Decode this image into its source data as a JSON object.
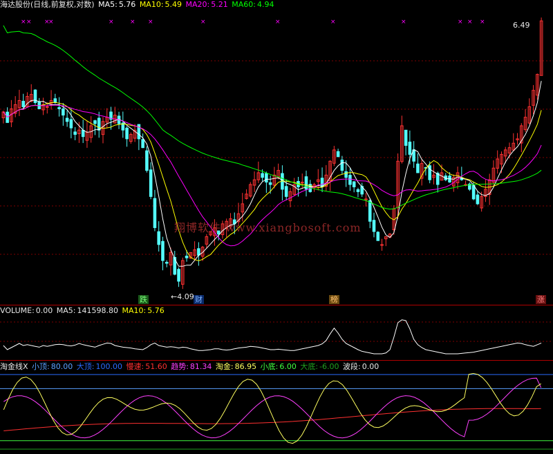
{
  "header": {
    "stock_label": "海达股份(日线,前复权,对数)",
    "ma5_label": "MA5:",
    "ma5_value": "5.76",
    "ma10_label": "MA10:",
    "ma10_value": "5.49",
    "ma20_label": "MA20:",
    "ma20_value": "5.21",
    "ma60_label": "MA60:",
    "ma60_value": "4.94"
  },
  "volume_header": {
    "volume_label": "VOLUME:",
    "volume_value": "0.00",
    "ma5_label": "MA5:",
    "ma5_value": "141598.80",
    "ma10_label": "MA10:",
    "ma10_value": "5.76"
  },
  "indicator_header": {
    "name": "淘金线X",
    "small_top_label": "小顶:",
    "small_top_value": "80.00",
    "big_top_label": "大顶:",
    "big_top_value": "100.00",
    "slow_label": "慢速:",
    "slow_value": "51.60",
    "trend_label": "趋势:",
    "trend_value": "81.34",
    "gold_label": "淘金:",
    "gold_value": "86.95",
    "small_bottom_label": "小底:",
    "small_bottom_value": "6.00",
    "big_bottom_label": "大底:",
    "big_bottom_value": "-6.00",
    "wave_label": "波段:",
    "wave_value": "0.00"
  },
  "watermark": "翔博软件 www.xiangbosoft.com",
  "price_annotations": {
    "high": "6.49",
    "low": "4.09"
  },
  "event_tags": {
    "fall": "跌",
    "finance": "财",
    "rank": "榜",
    "rise": "涨"
  },
  "colors": {
    "background": "#000000",
    "up_candle": "#ff3232",
    "down_candle": "#54ffff",
    "ma5": "#ffffff",
    "ma10": "#ffff00",
    "ma20": "#ff00ff",
    "ma60": "#00ff00",
    "separator": "#b00000",
    "grid": "#800000",
    "marker": "#ff00ff"
  },
  "chart_data": [
    {
      "type": "candlestick",
      "title": "海达股份(日线,前复权,对数)",
      "scale": "log",
      "ylim": [
        4.0,
        6.6
      ],
      "annotations": {
        "high": 6.49,
        "low": 4.09
      },
      "series_ma": [
        {
          "name": "MA5",
          "last": 5.76
        },
        {
          "name": "MA10",
          "last": 5.49
        },
        {
          "name": "MA20",
          "last": 5.21
        },
        {
          "name": "MA60",
          "last": 4.94
        }
      ],
      "close": [
        5.55,
        5.45,
        5.58,
        5.62,
        5.66,
        5.6,
        5.7,
        5.72,
        5.64,
        5.58,
        5.62,
        5.6,
        5.66,
        5.64,
        5.58,
        5.52,
        5.46,
        5.4,
        5.34,
        5.38,
        5.32,
        5.36,
        5.42,
        5.44,
        5.38,
        5.46,
        5.5,
        5.48,
        5.52,
        5.44,
        5.38,
        5.3,
        5.34,
        5.38,
        5.3,
        5.22,
        5.02,
        4.8,
        4.55,
        4.42,
        4.3,
        4.28,
        4.36,
        4.2,
        4.15,
        4.3,
        4.32,
        4.36,
        4.38,
        4.34,
        4.4,
        4.48,
        4.52,
        4.55,
        4.5,
        4.58,
        4.6,
        4.62,
        4.58,
        4.66,
        4.74,
        4.82,
        4.9,
        4.94,
        5.0,
        4.96,
        4.92,
        4.9,
        4.98,
        5.02,
        4.86,
        4.8,
        4.84,
        4.9,
        4.88,
        4.92,
        4.86,
        4.84,
        4.9,
        4.94,
        4.88,
        4.98,
        5.1,
        5.2,
        5.14,
        5.02,
        4.96,
        4.9,
        4.88,
        4.84,
        4.82,
        4.78,
        4.6,
        4.52,
        4.45,
        4.42,
        4.48,
        4.5,
        4.7,
        5.1,
        5.42,
        5.24,
        5.16,
        5.1,
        5.0,
        5.08,
        5.04,
        4.94,
        4.98,
        4.9,
        5.0,
        4.94,
        4.92,
        4.96,
        5.0,
        4.94,
        4.9,
        4.86,
        4.78,
        4.74,
        4.8,
        4.86,
        4.94,
        5.04,
        5.12,
        5.16,
        5.2,
        5.22,
        5.26,
        5.3,
        5.42,
        5.5,
        5.6,
        5.76,
        5.92,
        6.49
      ]
    },
    {
      "type": "line",
      "name": "VOLUME",
      "series": [
        {
          "name": "MA10",
          "last": 5.76
        }
      ],
      "values": [
        0.3,
        0.2,
        0.25,
        0.3,
        0.35,
        0.3,
        0.32,
        0.3,
        0.28,
        0.26,
        0.3,
        0.28,
        0.3,
        0.32,
        0.33,
        0.32,
        0.3,
        0.29,
        0.31,
        0.35,
        0.32,
        0.3,
        0.28,
        0.26,
        0.3,
        0.33,
        0.36,
        0.35,
        0.3,
        0.28,
        0.26,
        0.25,
        0.24,
        0.22,
        0.21,
        0.2,
        0.25,
        0.32,
        0.36,
        0.3,
        0.28,
        0.26,
        0.27,
        0.26,
        0.24,
        0.26,
        0.25,
        0.22,
        0.2,
        0.18,
        0.18,
        0.19,
        0.2,
        0.22,
        0.22,
        0.2,
        0.19,
        0.2,
        0.22,
        0.24,
        0.25,
        0.26,
        0.28,
        0.27,
        0.26,
        0.24,
        0.22,
        0.2,
        0.2,
        0.21,
        0.2,
        0.19,
        0.18,
        0.18,
        0.2,
        0.22,
        0.24,
        0.26,
        0.28,
        0.3,
        0.34,
        0.42,
        0.58,
        0.72,
        0.6,
        0.45,
        0.35,
        0.3,
        0.25,
        0.2,
        0.16,
        0.14,
        0.12,
        0.1,
        0.1,
        0.1,
        0.12,
        0.2,
        0.5,
        0.85,
        0.92,
        0.9,
        0.7,
        0.45,
        0.32,
        0.25,
        0.2,
        0.18,
        0.16,
        0.14,
        0.12,
        0.1,
        0.1,
        0.1,
        0.1,
        0.11,
        0.12,
        0.13,
        0.14,
        0.16,
        0.18,
        0.2,
        0.22,
        0.24,
        0.26,
        0.28,
        0.3,
        0.32,
        0.34,
        0.36,
        0.35,
        0.32,
        0.3,
        0.28,
        0.32,
        0.36
      ]
    },
    {
      "type": "line",
      "name": "淘金线X",
      "ylim": [
        -8,
        102
      ],
      "levels": {
        "小顶": 80,
        "大顶": 100,
        "小底": 6,
        "大底": -6
      },
      "series": [
        {
          "name": "慢速",
          "last": 51.6
        },
        {
          "name": "趋势",
          "last": 81.34
        },
        {
          "name": "淘金",
          "last": 86.95
        },
        {
          "name": "波段",
          "last": 0.0
        }
      ]
    }
  ]
}
